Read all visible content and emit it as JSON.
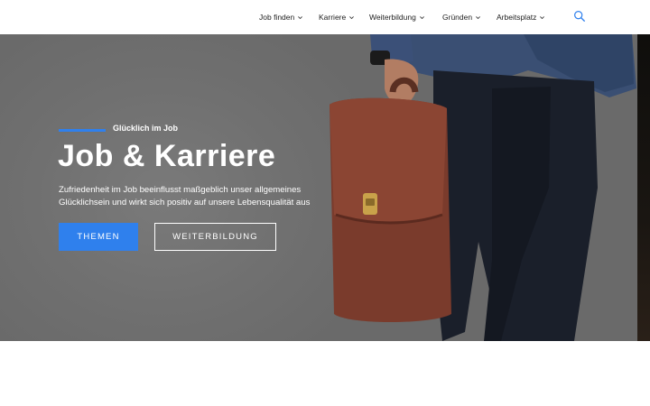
{
  "header": {
    "nav": [
      {
        "label": "Job finden"
      },
      {
        "label": "Karriere"
      },
      {
        "label": "Weiterbildung"
      },
      {
        "label": "Gründen"
      },
      {
        "label": "Arbeitsplatz"
      }
    ],
    "search_icon": "search-icon"
  },
  "hero": {
    "eyebrow": "Glücklich im Job",
    "title": "Job & Karriere",
    "subtitle_line1": "Zufriedenheit im Job beeinflusst maßgeblich unser allgemeines",
    "subtitle_line2": "Glücklichsein und wirkt sich positiv auf unsere Lebensqualität aus",
    "primary_button": "THEMEN",
    "secondary_button": "WEITERBILDUNG"
  },
  "colors": {
    "accent": "#2f80ed",
    "hero_overlay": "#6e6e6e",
    "header_bg": "#ffffff"
  }
}
